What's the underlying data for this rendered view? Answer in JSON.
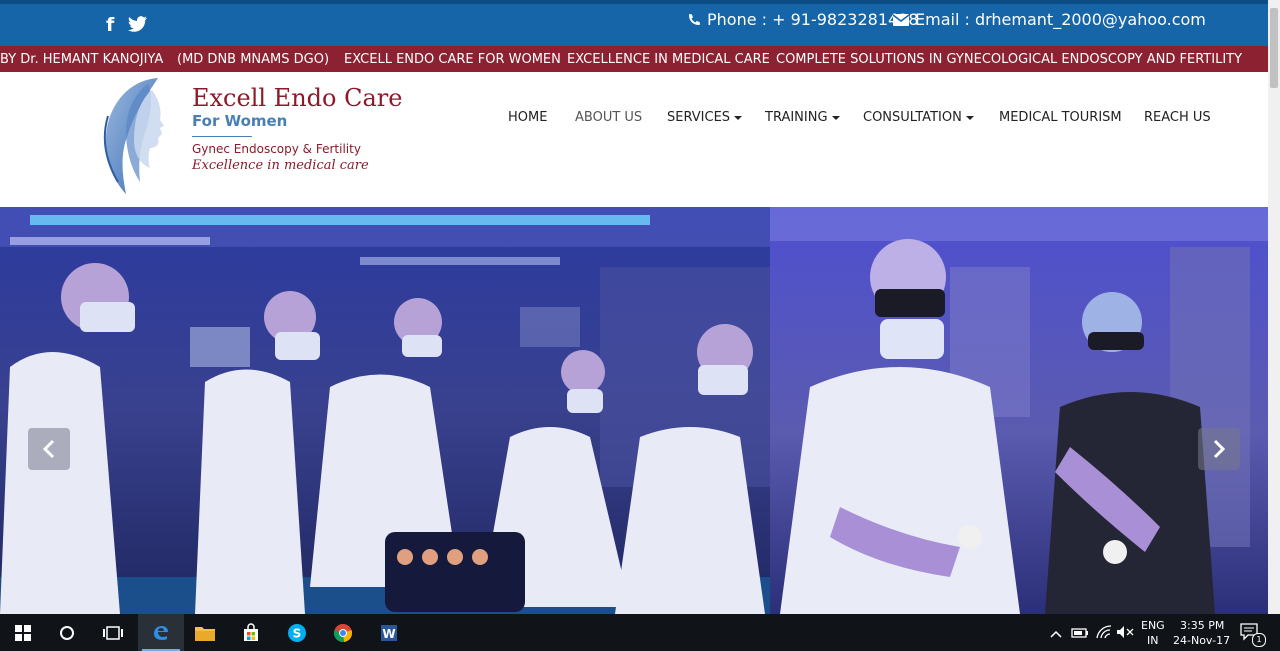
{
  "topbar": {
    "social": [
      "facebook-icon",
      "twitter-icon"
    ],
    "phone": "Phone : + 91-9823281428",
    "email": "Email : drhemant_2000@yahoo.com",
    "bg_color": "#1565a8"
  },
  "marquee": {
    "items": [
      "BY Dr. HEMANT KANOJIYA",
      "(MD DNB MNAMS DGO)",
      "EXCELL ENDO CARE FOR WOMEN",
      "EXCELLENCE IN MEDICAL CARE",
      "COMPLETE SOLUTIONS IN GYNECOLOGICAL ENDOSCOPY AND FERTILITY"
    ],
    "bg_color": "#8b2131"
  },
  "logo": {
    "title": "Excell Endo Care",
    "subtitle": "For Women",
    "tagline1": "Gynec Endoscopy & Fertility",
    "tagline2": "Excellence in medical care",
    "color": "#8b1a2b"
  },
  "nav": {
    "items": [
      "HOME",
      "ABOUT US",
      "SERVICES",
      "TRAINING",
      "CONSULTATION",
      "MEDICAL TOURISM",
      "REACH US"
    ],
    "active": "ABOUT US"
  },
  "slider": {
    "prev_icon": "chevron-left-icon",
    "next_icon": "chevron-right-icon"
  },
  "taskbar": {
    "apps": [
      "windows-start-icon",
      "cortana-icon",
      "task-view-icon",
      "edge-icon",
      "file-explorer-icon",
      "store-icon",
      "skype-icon",
      "chrome-icon",
      "word-icon"
    ],
    "lang_top": "ENG",
    "lang_bottom": "IN",
    "time": "3:35 PM",
    "date": "24-Nov-17",
    "notification_count": "1"
  }
}
